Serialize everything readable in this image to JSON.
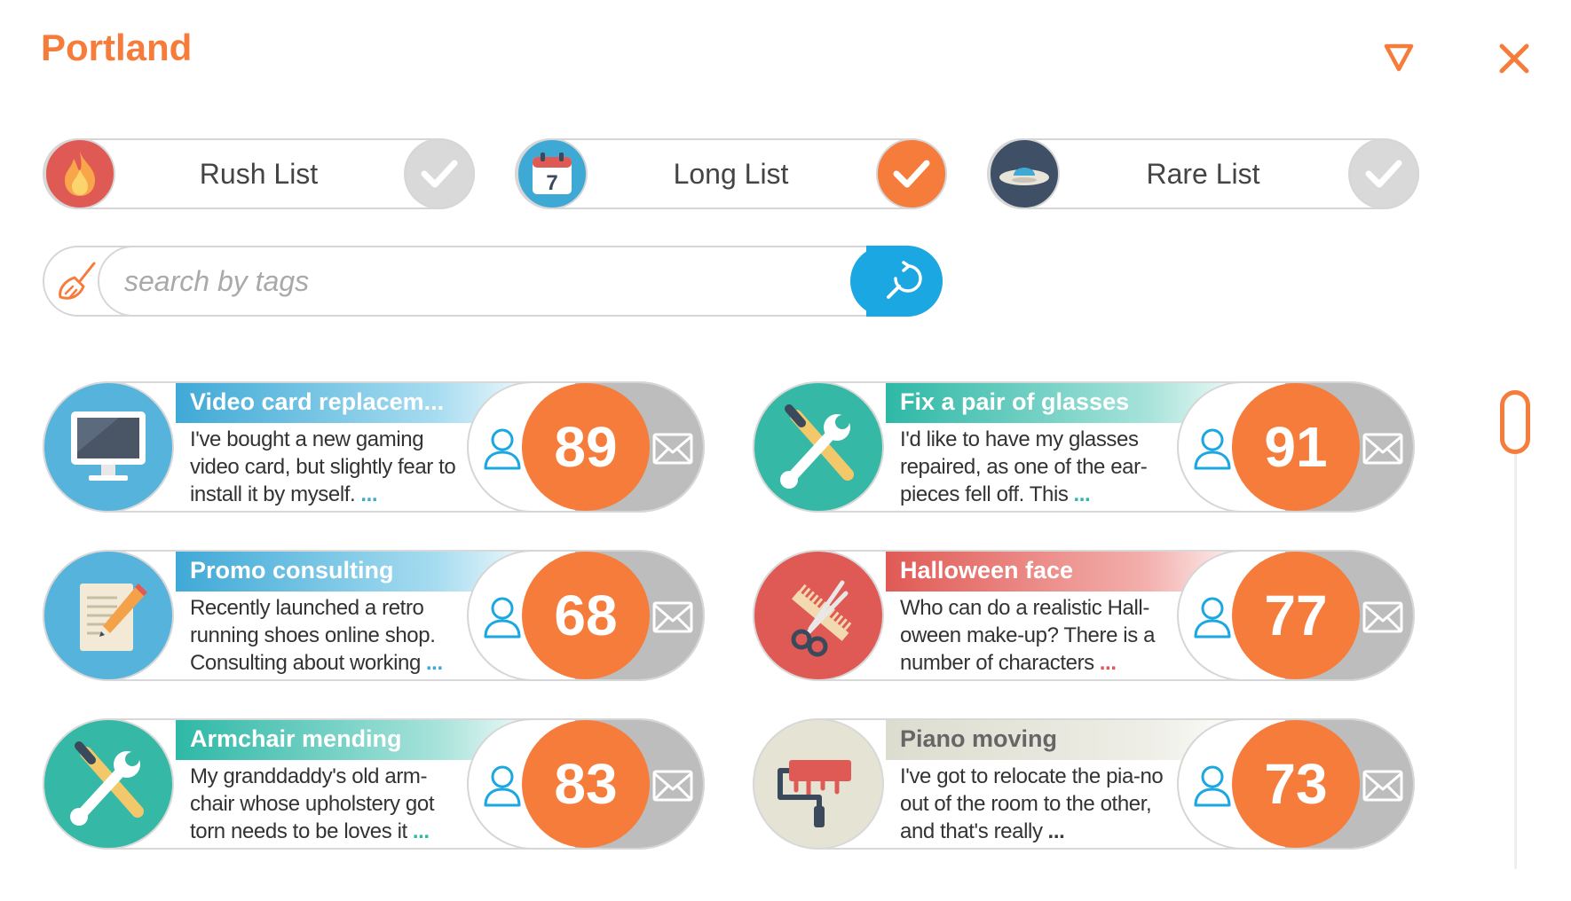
{
  "header": {
    "title": "Portland",
    "filter_icon": "filter-funnel-icon",
    "close_icon": "close-icon"
  },
  "colors": {
    "accent": "#f57c3a",
    "search_button": "#1ba7e1",
    "check_active": "#f57c3a",
    "check_inactive": "#d9d9d9"
  },
  "lists": [
    {
      "label": "Rush List",
      "icon": "fire-icon",
      "checked": false
    },
    {
      "label": "Long List",
      "icon": "calendar-icon",
      "calendar_day": "7",
      "checked": true
    },
    {
      "label": "Rare List",
      "icon": "ufo-icon",
      "checked": false
    }
  ],
  "search": {
    "placeholder": "search by tags",
    "clear_icon": "broom-icon",
    "search_icon": "search-refresh-icon"
  },
  "cards": [
    {
      "title": "Video card replacem...",
      "description": "I've bought a new gaming video card, but slightly fear to install it by myself.",
      "more": "...",
      "score": "89",
      "icon": "monitor-icon"
    },
    {
      "title": "Fix a pair of glasses",
      "description": "I'd like to have my glasses repaired, as one of the ear-pieces fell off. This",
      "more": "...",
      "score": "91",
      "icon": "tools-icon"
    },
    {
      "title": "Promo consulting",
      "description": "Recently launched a retro running shoes online shop. Consulting about working",
      "more": "...",
      "score": "68",
      "icon": "pencil-notepad-icon"
    },
    {
      "title": "Halloween face",
      "description": "Who can do a realistic Hall-oween make-up? There is a number of characters",
      "more": "...",
      "score": "77",
      "icon": "comb-scissors-icon"
    },
    {
      "title": "Armchair mending",
      "description": "My granddaddy's old arm-chair whose upholstery got torn needs to be loves it",
      "more": "...",
      "score": "83",
      "icon": "tools-icon"
    },
    {
      "title": "Piano moving",
      "description": "I've got to relocate the pia-no out of the room to the other, and that's really",
      "more": "...",
      "score": "73",
      "icon": "paint-roller-icon"
    }
  ]
}
